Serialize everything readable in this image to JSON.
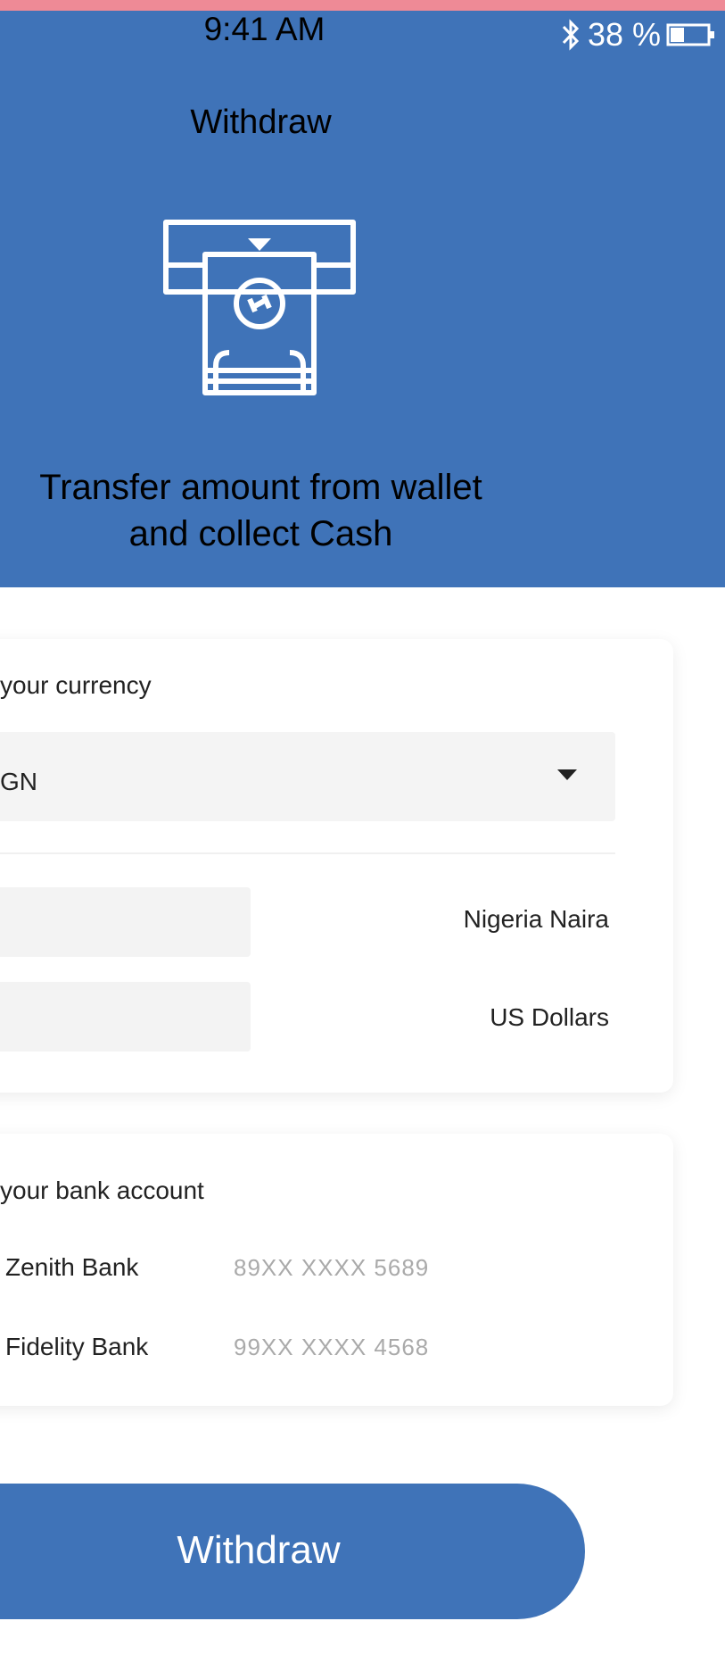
{
  "status_bar": {
    "time": "9:41 AM",
    "battery": "38 %"
  },
  "header": {
    "title": "Withdraw",
    "subtitle_line1": "Transfer amount from wallet",
    "subtitle_line2": "and collect Cash"
  },
  "currency_card": {
    "label": "your currency",
    "selected_value": "GN",
    "field1_value": "",
    "currency1": "Nigeria  Naira",
    "currency2": "US Dollars"
  },
  "bank_card": {
    "label": "your bank account",
    "accounts": [
      {
        "name": "Zenith Bank",
        "number": "89XX  XXXX  5689"
      },
      {
        "name": "Fidelity Bank",
        "number": "99XX  XXXX  4568"
      }
    ]
  },
  "withdraw_button": {
    "label": "Withdraw"
  },
  "colors": {
    "primary": "#3f73b8",
    "top_strip": "#ee8a96"
  },
  "icons": [
    "bluetooth-icon",
    "battery-icon",
    "atm-cash-icon",
    "dropdown-arrow-icon"
  ]
}
